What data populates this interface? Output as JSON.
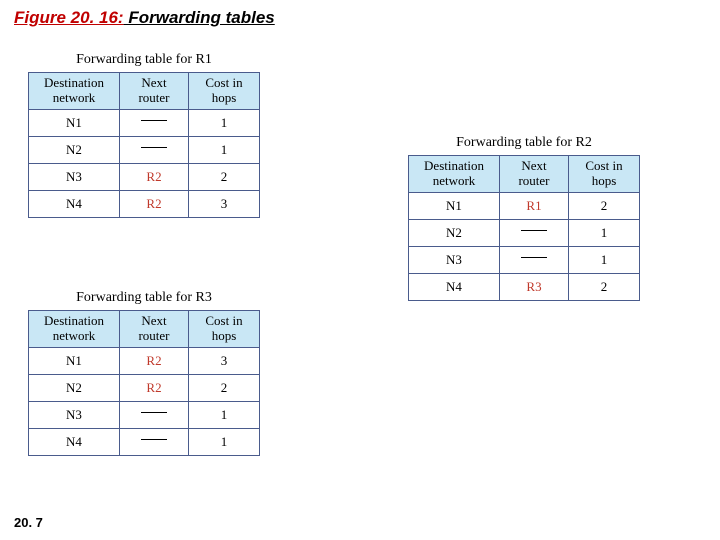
{
  "title": {
    "number": "Figure 20. 16:",
    "label": " Forwarding tables"
  },
  "slide_number": "20. 7",
  "header": {
    "col1a": "Destination",
    "col1b": "network",
    "col2a": "Next",
    "col2b": "router",
    "col3a": "Cost in",
    "col3b": "hops"
  },
  "tables": {
    "r1": {
      "caption": "Forwarding table for R1",
      "rows": [
        {
          "dest": "N1",
          "next": "",
          "cost": "1"
        },
        {
          "dest": "N2",
          "next": "",
          "cost": "1"
        },
        {
          "dest": "N3",
          "next": "R2",
          "cost": "2"
        },
        {
          "dest": "N4",
          "next": "R2",
          "cost": "3"
        }
      ]
    },
    "r2": {
      "caption": "Forwarding table for R2",
      "rows": [
        {
          "dest": "N1",
          "next": "R1",
          "cost": "2"
        },
        {
          "dest": "N2",
          "next": "",
          "cost": "1"
        },
        {
          "dest": "N3",
          "next": "",
          "cost": "1"
        },
        {
          "dest": "N4",
          "next": "R3",
          "cost": "2"
        }
      ]
    },
    "r3": {
      "caption": "Forwarding table for R3",
      "rows": [
        {
          "dest": "N1",
          "next": "R2",
          "cost": "3"
        },
        {
          "dest": "N2",
          "next": "R2",
          "cost": "2"
        },
        {
          "dest": "N3",
          "next": "",
          "cost": "1"
        },
        {
          "dest": "N4",
          "next": "",
          "cost": "1"
        }
      ]
    }
  }
}
